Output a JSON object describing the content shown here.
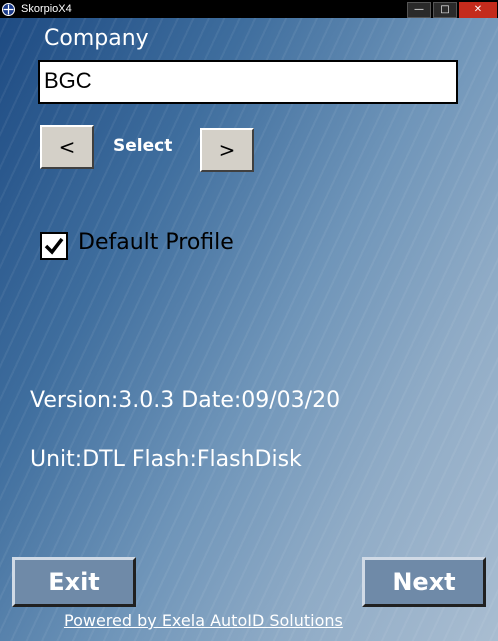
{
  "window": {
    "title": "SkorpioX4"
  },
  "form": {
    "company_label": "Company",
    "company_value": "BGC",
    "prev_label": "<",
    "select_label": "Select",
    "next_label": ">",
    "default_profile_label": "Default Profile",
    "default_profile_checked": true
  },
  "info": {
    "version_line": "Version:3.0.3 Date:09/03/20",
    "unit_line": "Unit:DTL Flash:FlashDisk"
  },
  "buttons": {
    "exit_label": "Exit",
    "next_label": "Next"
  },
  "footer": {
    "text": "Powered by Exela AutoID Solutions"
  }
}
